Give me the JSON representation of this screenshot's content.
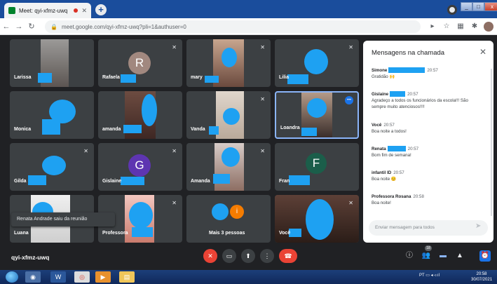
{
  "browser": {
    "tab_title": "Meet: qyi-xfmz-uwq",
    "tab_close": "✕",
    "new_tab": "+",
    "url": "meet.google.com/qyi-xfmz-uwq?pli=1&authuser=0"
  },
  "tiles": [
    {
      "name": "Larissa",
      "muted": false
    },
    {
      "name": "Rafaela",
      "muted": true,
      "initial": "R"
    },
    {
      "name": "mary",
      "muted": true
    },
    {
      "name": "Lilia",
      "muted": true
    },
    {
      "name": "Monica",
      "muted": false
    },
    {
      "name": "amanda",
      "muted": false
    },
    {
      "name": "Vanda",
      "muted": true
    },
    {
      "name": "Loandra",
      "muted": false
    },
    {
      "name": "Gilda",
      "muted": true
    },
    {
      "name": "Gislaine",
      "muted": true,
      "initial": "G"
    },
    {
      "name": "Amanda",
      "muted": true
    },
    {
      "name": "Fran",
      "muted": false,
      "initial": "F"
    },
    {
      "name": "Luana",
      "muted": false
    },
    {
      "name": "Professora",
      "muted": true
    },
    {
      "name": "Mais 3 pessoas",
      "muted": false,
      "initial": "i"
    },
    {
      "name": "Você",
      "muted": true
    }
  ],
  "toast": "Renata Andrade saiu da reunião",
  "chat": {
    "title": "Mensagens na chamada",
    "close": "✕",
    "messages": [
      {
        "sender": "Simone",
        "time": "20:57",
        "text": "Gratidão 🙌"
      },
      {
        "sender": "Gislaine",
        "time": "20:57",
        "text": "Agradeço a todos os funcionários da escola!!! São sempre muito atenciosos!!!!"
      },
      {
        "sender": "Você",
        "time": "20:57",
        "text": "Boa noite a todos!"
      },
      {
        "sender": "Renata",
        "time": "20:57",
        "text": "Bom fim de semana!"
      },
      {
        "sender": "infantil ID",
        "time": "20:57",
        "text": "Boa noite 😊"
      },
      {
        "sender": "Professora Rosana",
        "time": "20:58",
        "text": "Boa noite!"
      }
    ],
    "input_placeholder": "Enviar mensagem para todos"
  },
  "meeting_code": "qyi-xfmz-uwq",
  "participants_badge": "18",
  "taskbar": {
    "tray_lang": "PT",
    "clock_time": "20:58",
    "clock_date": "30/07/2021"
  },
  "colors": {
    "meet_bg": "#202124",
    "tile_bg": "#3c4043",
    "redact": "#1ea1f2",
    "danger": "#ea4335",
    "accent": "#1a73e8"
  }
}
